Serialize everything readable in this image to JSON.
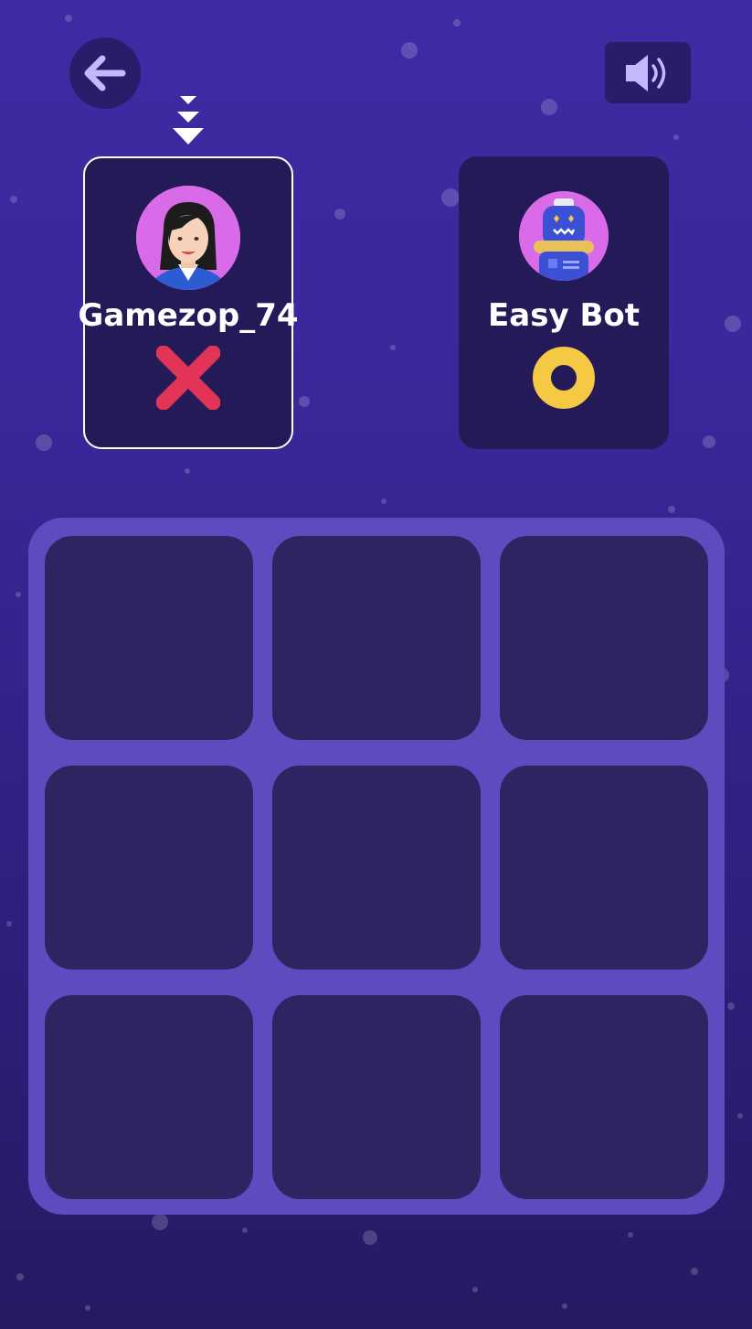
{
  "header": {
    "back_icon": "arrow-left-icon",
    "sound_icon": "speaker-icon"
  },
  "turn_indicator_icon": "chevron-down-icon",
  "players": [
    {
      "name": "Gamezop_74",
      "avatar_icon": "woman-avatar-icon",
      "symbol": "X",
      "symbol_icon": "x-mark-icon",
      "active": true
    },
    {
      "name": "Easy Bot",
      "avatar_icon": "robot-avatar-icon",
      "symbol": "O",
      "symbol_icon": "o-mark-icon",
      "active": false
    }
  ],
  "board": {
    "rows": 3,
    "cols": 3,
    "cells": [
      "",
      "",
      "",
      "",
      "",
      "",
      "",
      "",
      ""
    ]
  },
  "colors": {
    "background": "#3a279a",
    "board": "#604abf",
    "cell": "#2f2362",
    "card": "#251a58",
    "x_mark": "#e23456",
    "o_mark": "#f6c945",
    "avatar_bg": "#d96be8"
  }
}
